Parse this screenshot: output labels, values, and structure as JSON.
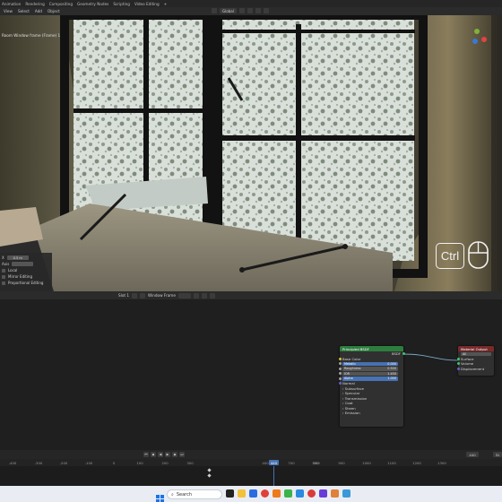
{
  "top_menu": {
    "tabs": [
      "Animation",
      "Rendering",
      "Compositing",
      "Geometry Nodes",
      "Scripting",
      "Video Editing"
    ],
    "add": "+"
  },
  "viewport_header": {
    "menus": [
      "View",
      "Select",
      "Add",
      "Object"
    ],
    "transform_orientation": "Global"
  },
  "viewport": {
    "view_label": "Room Window frame (Frame) 1"
  },
  "operator_panel": {
    "rows": [
      {
        "label": "X",
        "value": "0.5 m"
      },
      {
        "label": "Axis",
        "value": ""
      },
      {
        "label": "",
        "value": "Local"
      }
    ],
    "checks": [
      "Mirror Editing",
      "Proportional Editing"
    ]
  },
  "overlay": {
    "key_label": "Ctrl",
    "mouse_icon": "mouse-icon"
  },
  "node_header": {
    "slot": "Slot 1",
    "material": "Window Frame"
  },
  "principled_node": {
    "title": "Principled BSDF",
    "output": "BSDF",
    "rows": [
      {
        "label": "Base Color",
        "type": "socket"
      },
      {
        "label": "Metallic",
        "value": "0.000",
        "style": "blue"
      },
      {
        "label": "Roughness",
        "value": "0.500",
        "style": "grey"
      },
      {
        "label": "IOR",
        "value": "1.450",
        "style": "grey"
      },
      {
        "label": "Alpha",
        "value": "1.000",
        "style": "blue"
      },
      {
        "label": "Normal",
        "type": "socket"
      }
    ],
    "panels": [
      "Subsurface",
      "Specular",
      "Transmission",
      "Coat",
      "Sheen",
      "Emission"
    ]
  },
  "output_node": {
    "title": "Material Output",
    "target": "All",
    "inputs": [
      "Surface",
      "Volume",
      "Displacement"
    ]
  },
  "timeline": {
    "ticks": [
      "-400",
      "-300",
      "-200",
      "-100",
      "0",
      "100",
      "200",
      "300",
      "400",
      "500",
      "700",
      "800",
      "900",
      "1000",
      "1100",
      "1200",
      "1300"
    ],
    "current_frame": "440",
    "end_frame": "440",
    "start_label": "St"
  },
  "taskbar": {
    "search_placeholder": "Search"
  },
  "colors": {
    "accent": "#4772b3",
    "node_shader_header": "#2d7d3e",
    "node_output_header": "#7a2a2a",
    "current_frame": "#4772b3"
  }
}
